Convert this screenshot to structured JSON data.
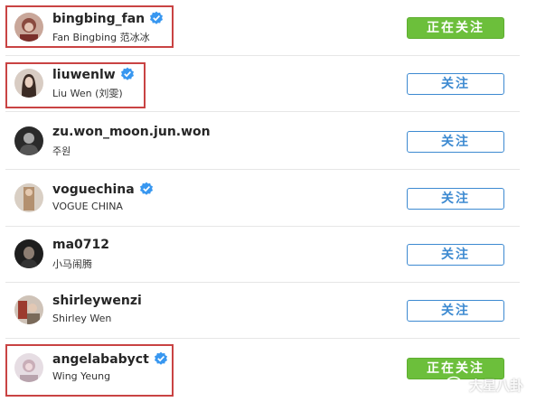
{
  "accounts": [
    {
      "username": "bingbing_fan",
      "fullname": "Fan Bingbing 范冰冰",
      "verified": true,
      "button_label": "正在关注",
      "state": "following",
      "highlighted": true
    },
    {
      "username": "liuwenlw",
      "fullname": "Liu Wen (刘雯)",
      "verified": true,
      "button_label": "关注",
      "state": "follow",
      "highlighted": true
    },
    {
      "username": "zu.won_moon.jun.won",
      "fullname": "주원",
      "verified": false,
      "button_label": "关注",
      "state": "follow",
      "highlighted": false
    },
    {
      "username": "voguechina",
      "fullname": "VOGUE CHINA",
      "verified": true,
      "button_label": "关注",
      "state": "follow",
      "highlighted": false
    },
    {
      "username": "ma0712",
      "fullname": "小马闹腾",
      "verified": false,
      "button_label": "关注",
      "state": "follow",
      "highlighted": false
    },
    {
      "username": "shirleywenzi",
      "fullname": "Shirley Wen",
      "verified": false,
      "button_label": "关注",
      "state": "follow",
      "highlighted": false
    },
    {
      "username": "angelababyct",
      "fullname": "Wing Yeung",
      "verified": true,
      "button_label": "正在关注",
      "state": "following",
      "highlighted": true
    }
  ],
  "watermark": {
    "text": "大星八卦",
    "icon": "wechat-icon"
  },
  "colors": {
    "follow_border": "#3d8ad1",
    "following_bg": "#6cbf3b",
    "verified_badge": "#3897f0",
    "highlight_box": "#c94343"
  }
}
